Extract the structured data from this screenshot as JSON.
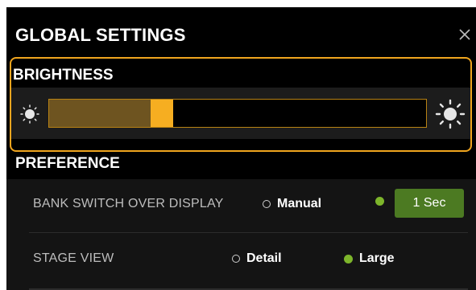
{
  "dialog": {
    "title": "GLOBAL SETTINGS",
    "close_icon": "close-icon"
  },
  "brightness": {
    "label": "BRIGHTNESS",
    "level": 0.27,
    "accent_color": "#f6ae21",
    "left_icon": "sun-small-icon",
    "right_icon": "sun-large-icon"
  },
  "preference": {
    "label": "PREFERENCE",
    "rows": [
      {
        "label": "BANK SWITCH OVER DISPLAY",
        "options": [
          "Manual",
          "1 Sec"
        ],
        "selected": "1 Sec"
      },
      {
        "label": "STAGE VIEW",
        "options": [
          "Detail",
          "Large"
        ],
        "selected": "Large"
      }
    ],
    "selected_color": "#7db52b",
    "button_color": "#4c7a22"
  }
}
